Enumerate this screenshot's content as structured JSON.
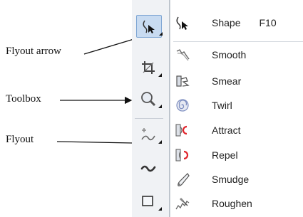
{
  "callouts": {
    "flyout_arrow": "Flyout arrow",
    "toolbox": "Toolbox",
    "flyout": "Flyout"
  },
  "toolbox": {
    "tools": [
      {
        "icon": "shape-tool-icon",
        "active": true
      },
      {
        "icon": "crop-tool-icon",
        "active": false
      },
      {
        "icon": "zoom-tool-icon",
        "active": false
      },
      {
        "icon": "freehand-tool-icon",
        "active": false
      },
      {
        "icon": "smart-drawing-tool-icon",
        "active": false
      },
      {
        "icon": "rectangle-tool-icon",
        "active": false
      }
    ]
  },
  "flyout": {
    "items": [
      {
        "label": "Shape",
        "shortcut": "F10",
        "icon": "shape-icon"
      },
      {
        "label": "Smooth",
        "shortcut": "",
        "icon": "smooth-icon"
      },
      {
        "label": "Smear",
        "shortcut": "",
        "icon": "smear-icon"
      },
      {
        "label": "Twirl",
        "shortcut": "",
        "icon": "twirl-icon"
      },
      {
        "label": "Attract",
        "shortcut": "",
        "icon": "attract-icon"
      },
      {
        "label": "Repel",
        "shortcut": "",
        "icon": "repel-icon"
      },
      {
        "label": "Smudge",
        "shortcut": "",
        "icon": "smudge-icon"
      },
      {
        "label": "Roughen",
        "shortcut": "",
        "icon": "roughen-icon"
      }
    ]
  },
  "colors": {
    "active_tool_bg": "#c8dbf1",
    "attract_repel_accent": "#e0242c",
    "twirl_accent": "#7d8ec0"
  }
}
